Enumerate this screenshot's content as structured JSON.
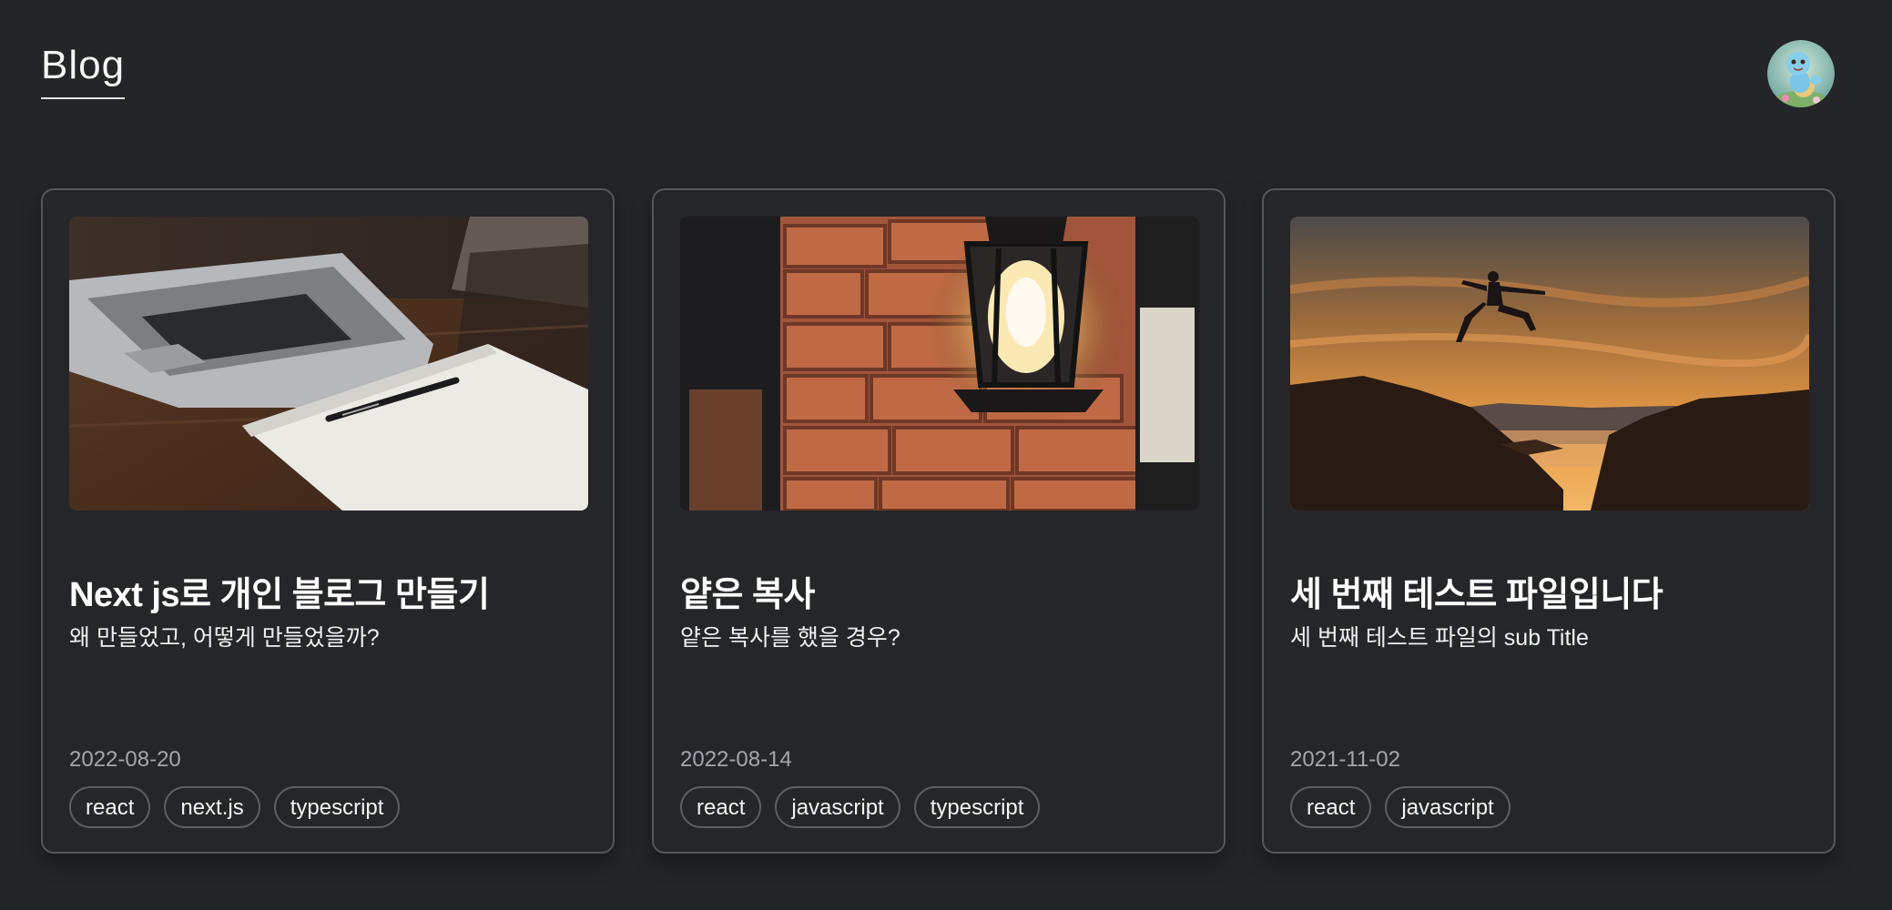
{
  "header": {
    "title": "Blog"
  },
  "posts": [
    {
      "title": "Next js로 개인 블로그 만들기",
      "subtitle": "왜 만들었고, 어떻게 만들었을까?",
      "date": "2022-08-20",
      "tags": [
        "react",
        "next.js",
        "typescript"
      ]
    },
    {
      "title": "얕은 복사",
      "subtitle": "얕은 복사를 했을 경우?",
      "date": "2022-08-14",
      "tags": [
        "react",
        "javascript",
        "typescript"
      ]
    },
    {
      "title": "세 번째 테스트 파일입니다",
      "subtitle": "세 번째 테스트 파일의 sub Title",
      "date": "2021-11-02",
      "tags": [
        "react",
        "javascript"
      ]
    }
  ],
  "colors": {
    "background": "#242529",
    "card_border": "#55575d",
    "date_text": "#a4a6ad"
  }
}
